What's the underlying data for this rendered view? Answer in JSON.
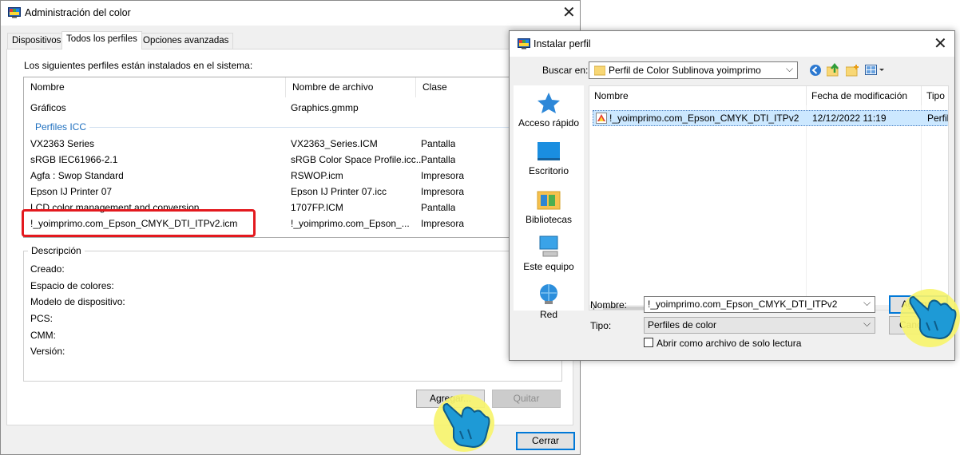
{
  "dialog1": {
    "title": "Administración del color",
    "tabs": [
      "Dispositivos",
      "Todos los perfiles",
      "Opciones avanzadas"
    ],
    "intro": "Los siguientes perfiles están instalados en el sistema:",
    "columns": [
      "Nombre",
      "Nombre de archivo",
      "Clase"
    ],
    "rows": [
      {
        "name": "Gráficos",
        "file": "Graphics.gmmp",
        "class": ""
      },
      {
        "group": "Perfiles ICC"
      },
      {
        "name": "VX2363 Series",
        "file": "VX2363_Series.ICM",
        "class": "Pantalla"
      },
      {
        "name": "sRGB IEC61966-2.1",
        "file": "sRGB Color Space Profile.icc...",
        "class": "Pantalla"
      },
      {
        "name": "Agfa : Swop Standard",
        "file": "RSWOP.icm",
        "class": "Impresora"
      },
      {
        "name": "Epson IJ Printer 07",
        "file": "Epson IJ Printer 07.icc",
        "class": "Impresora"
      },
      {
        "name": "LCD color management and conversion",
        "file": "1707FP.ICM",
        "class": "Pantalla"
      },
      {
        "name": "!_yoimprimo.com_Epson_CMYK_DTI_ITPv2.icm",
        "file": "!_yoimprimo.com_Epson_...",
        "class": "Impresora"
      }
    ],
    "description": {
      "legend": "Descripción",
      "fields": [
        "Creado:",
        "Espacio de colores:",
        "Modelo de dispositivo:",
        "PCS:",
        "CMM:",
        "Versión:"
      ]
    },
    "buttons": {
      "add": "Agregar...",
      "remove": "Quitar",
      "close": "Cerrar"
    }
  },
  "dialog2": {
    "title": "Instalar perfil",
    "lookin_label": "Buscar en:",
    "lookin_value": "Perfil de Color Sublinova yoimprimo",
    "places": [
      "Acceso rápido",
      "Escritorio",
      "Bibliotecas",
      "Este equipo",
      "Red"
    ],
    "columns": [
      "Nombre",
      "Fecha de modificación",
      "Tipo"
    ],
    "files": [
      {
        "name": "!_yoimprimo.com_Epson_CMYK_DTI_ITPv2",
        "date": "12/12/2022 11:19",
        "type": "Perfil"
      }
    ],
    "filename_label": "Nombre:",
    "filename_value": "!_yoimprimo.com_Epson_CMYK_DTI_ITPv2",
    "type_label": "Tipo:",
    "type_value": "Perfiles de color",
    "readonly_label": "Abrir como archivo de solo lectura",
    "buttons": {
      "add": "Agregar",
      "cancel": "Cancelar"
    }
  },
  "colors": {
    "highlight": "#e3191e",
    "accent": "#0078d7",
    "selection": "#cce8ff",
    "group_text": "#1e6fbf",
    "hand_circle": "#f7f46e",
    "hand": "#1e9ad6"
  }
}
